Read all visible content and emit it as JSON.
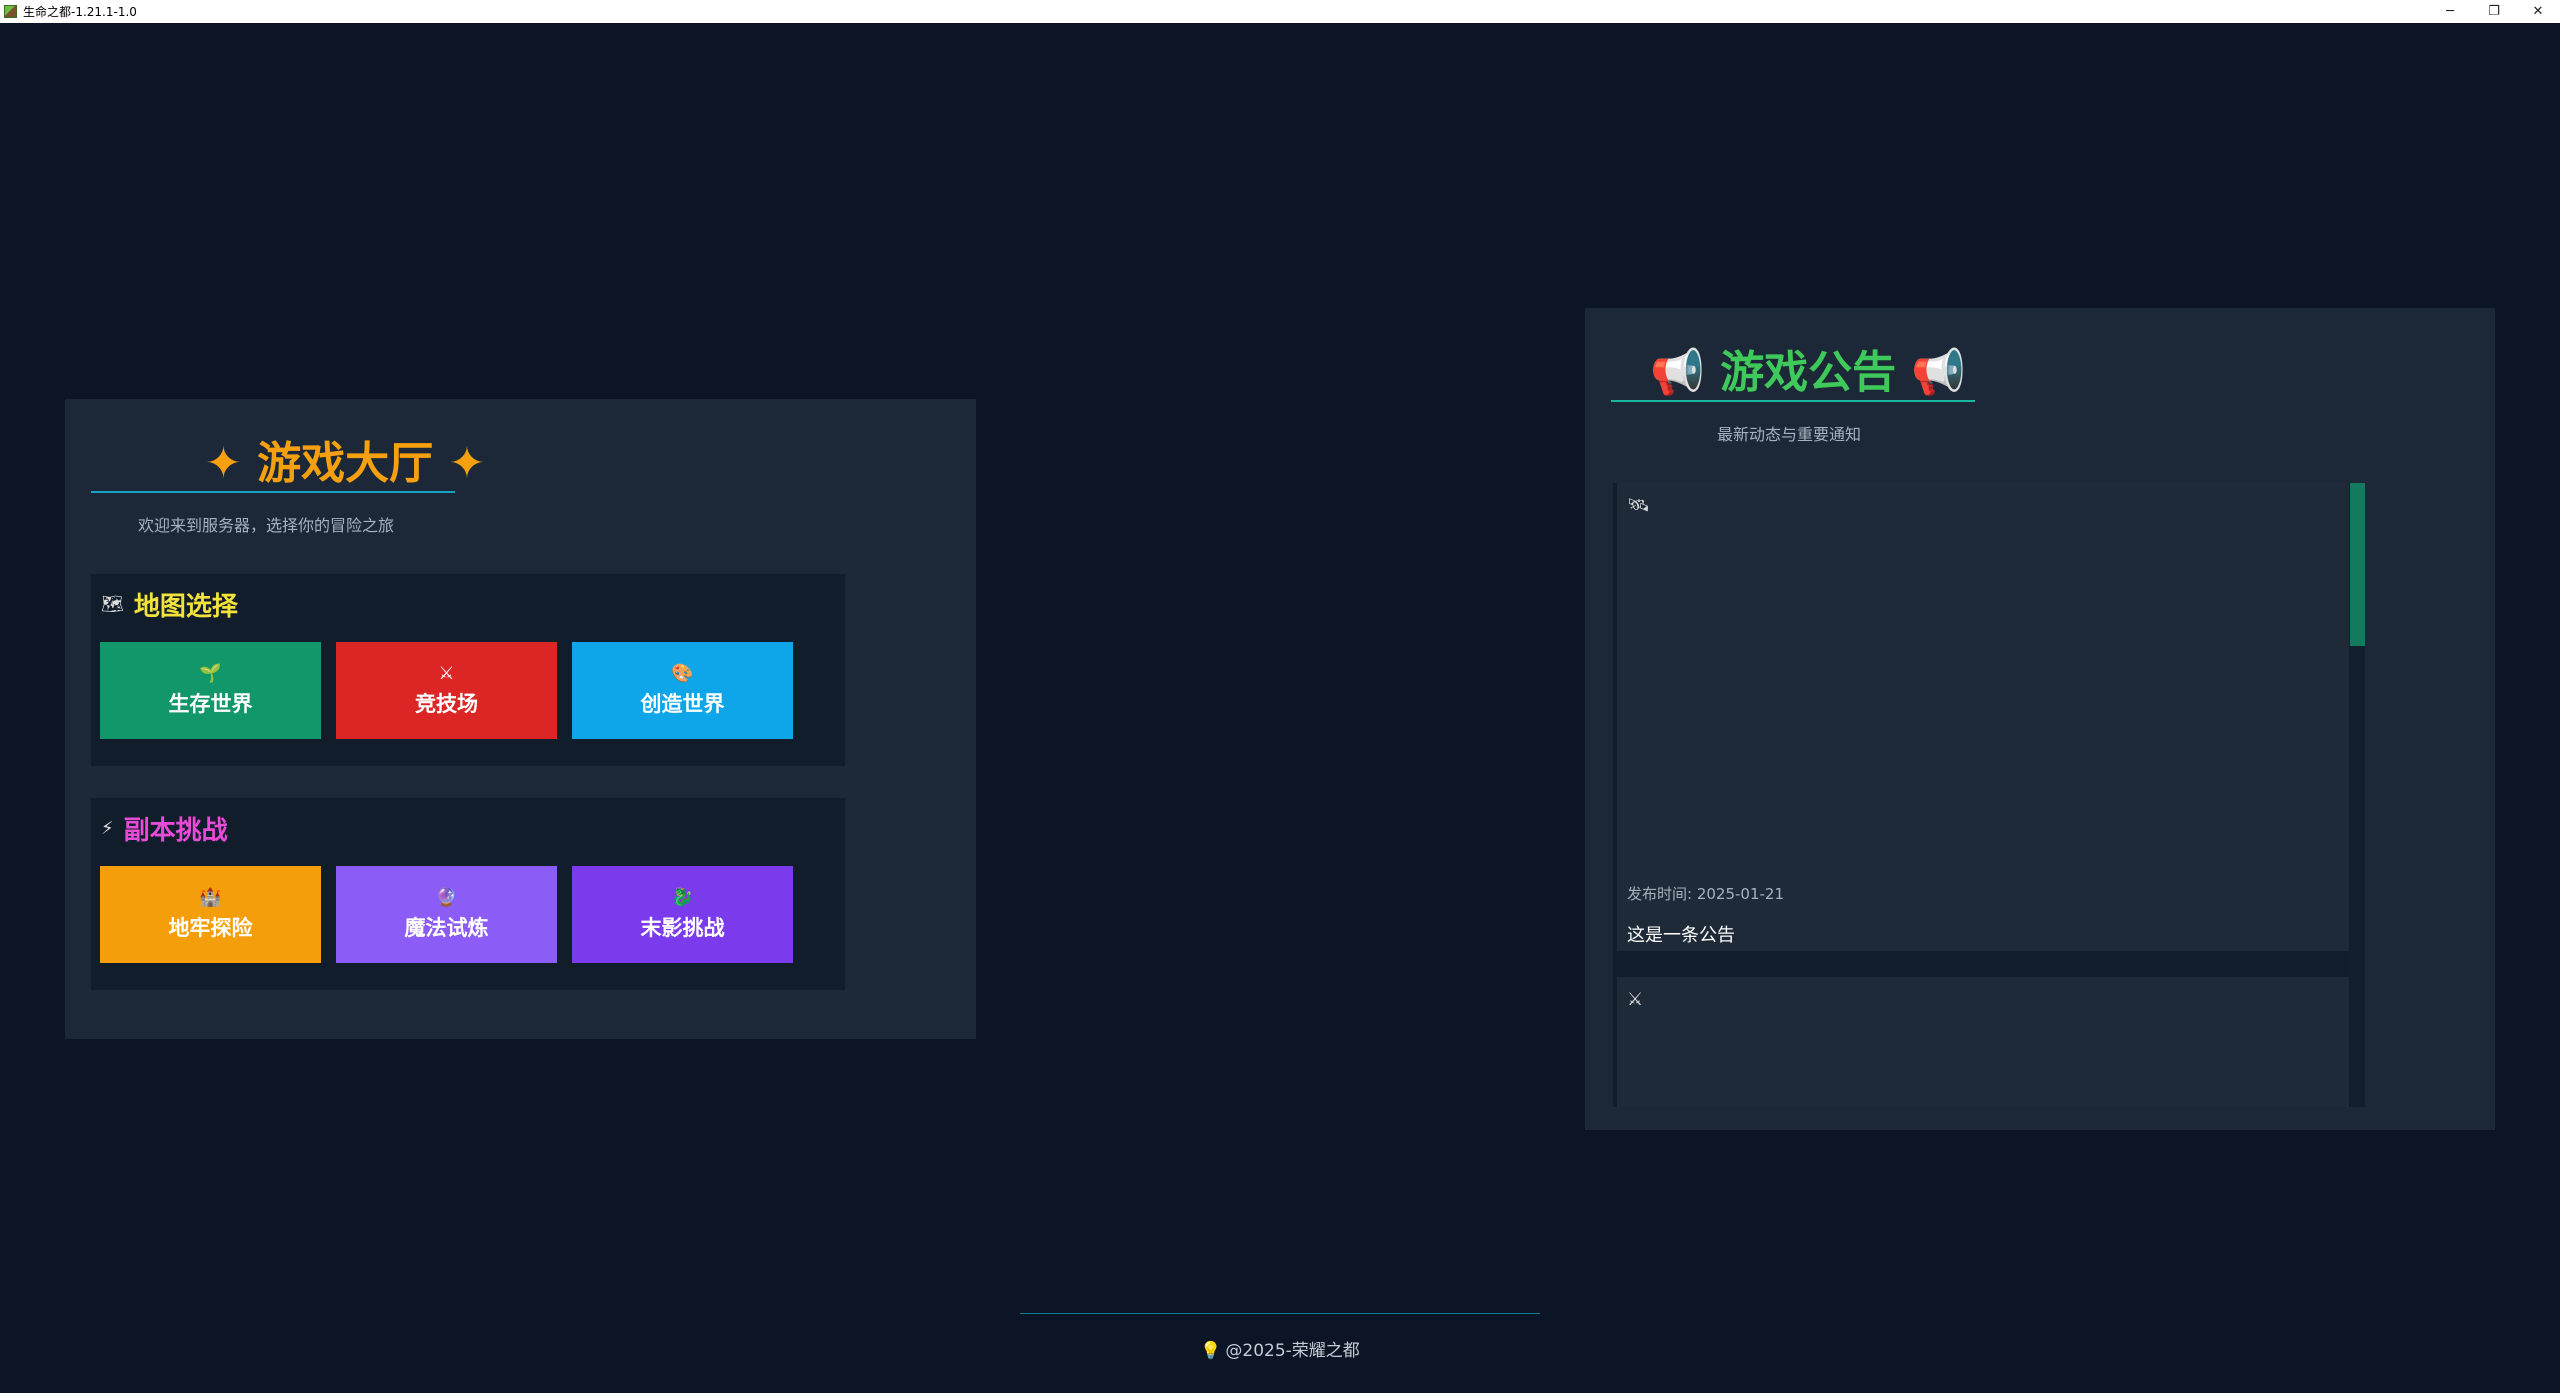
{
  "window": {
    "title": "生命之都-1.21.1-1.0",
    "controls": {
      "minimize": "─",
      "restore": "❐",
      "close": "✕"
    }
  },
  "lobby": {
    "title": "✦ 游戏大厅 ✦",
    "subtitle": "欢迎来到服务器，选择你的冒险之旅",
    "map_section": {
      "icon": "🗺",
      "title": "地图选择",
      "tiles": [
        {
          "icon": "🌱",
          "label": "生存世界",
          "color": "#12976a"
        },
        {
          "icon": "⚔",
          "label": "竞技场",
          "color": "#dc2626"
        },
        {
          "icon": "🎨",
          "label": "创造世界",
          "color": "#0ea5e9"
        }
      ]
    },
    "dungeon_section": {
      "icon": "⚡",
      "title": "副本挑战",
      "tiles": [
        {
          "icon": "🏰",
          "label": "地牢探险",
          "color": "#f59e0b"
        },
        {
          "icon": "🔮",
          "label": "魔法试炼",
          "color": "#8b5cf6"
        },
        {
          "icon": "🐉",
          "label": "末影挑战",
          "color": "#7c3aed"
        }
      ]
    }
  },
  "notice": {
    "title": "📢 游戏公告 📢",
    "subtitle": "最新动态与重要通知",
    "items": [
      {
        "icon": "🛰",
        "date": "发布时间: 2025-01-21",
        "text": "这是一条公告"
      },
      {
        "icon": "⚔"
      }
    ]
  },
  "footer": {
    "icon": "💡",
    "text": "@2025-荣耀之都"
  }
}
